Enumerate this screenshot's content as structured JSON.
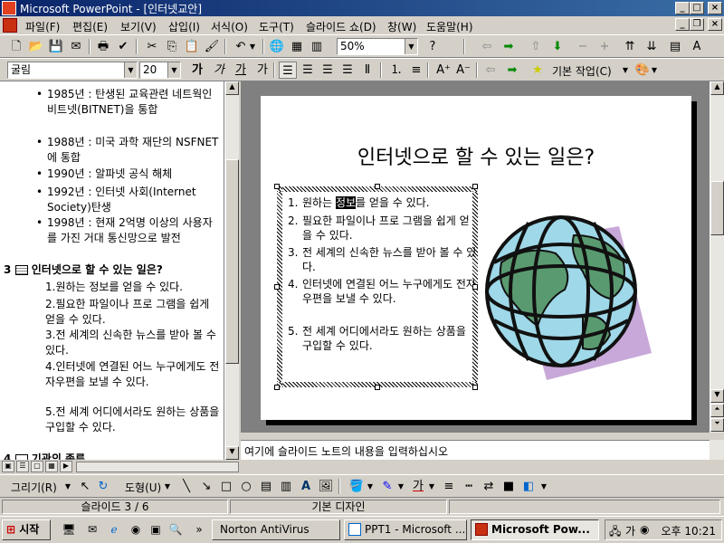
{
  "window": {
    "title": "Microsoft PowerPoint - [인터넷교안]",
    "caption_buttons": [
      "_",
      "□",
      "×"
    ],
    "doc_caption_buttons": [
      "_",
      "❐",
      "×"
    ]
  },
  "menu": [
    "파일(F)",
    "편집(E)",
    "보기(V)",
    "삽입(I)",
    "서식(O)",
    "도구(T)",
    "슬라이드 쇼(D)",
    "창(W)",
    "도움말(H)"
  ],
  "standard_toolbar": {
    "zoom": "50%"
  },
  "format_toolbar": {
    "font": "굴림",
    "size": "20",
    "char_style_labels": [
      "가",
      "가",
      "가",
      "가"
    ],
    "common_tasks": "기본 작업(C)"
  },
  "outline": {
    "bullets": [
      "1985년 : 탄생된 교육관련 네트웍인 비트넷(BITNET)을 통합",
      "1988년 : 미국 과학 재단의 NSFNET에 통합",
      "1990년 : 알파넷 공식 해체",
      "1992년 : 인터넷 사회(Internet Society)탄생",
      "1998년 : 현재 2억명 이상의 사용자를 가진 거대 통신망으로 발전"
    ],
    "slide3_number": "3",
    "slide3_title": "인터넷으로 할 수 있는 일은?",
    "slide3_items": [
      "1.원하는 정보를 얻을 수 있다.",
      "2.필요한  파일이나 프로 그램을 쉽게 얻을 수 있다.",
      "3.전 세계의 신속한 뉴스를 받아 볼 수 있다.",
      "4.인터넷에 연결된 어느 누구에게도 전자우편을 보낼 수 있다.",
      "5.전 세계 어디에서라도 원하는 상품을 구입할 수 있다."
    ],
    "slide4_number": "4",
    "slide4_title": "기관의 종류"
  },
  "slide": {
    "title": "인터넷으로 할 수 있는 일은?",
    "items": [
      {
        "num": "1.",
        "before": "원하는 ",
        "highlight": "정보",
        "after": "를 얻을 수 있다."
      },
      {
        "num": "2.",
        "text": "필요한  파일이나 프로 그램을 쉽게 얻을 수 있다."
      },
      {
        "num": "3.",
        "text": "전 세계의 신속한 뉴스를 받아 볼 수 있다."
      },
      {
        "num": "4.",
        "text": "인터넷에 연결된 어느 누구에게도 전자우편을 보낼 수 있다."
      },
      {
        "num": "5.",
        "text": "전 세계 어디에서라도 원하는 상품을 구입할 수 있다."
      }
    ]
  },
  "notes": {
    "placeholder": "여기에 슬라이드 노트의 내용을 입력하십시오"
  },
  "drawing_toolbar": {
    "draw": "그리기(R)",
    "autoshapes": "도형(U)"
  },
  "status": {
    "slide": "슬라이드 3 / 6",
    "design": "기본 디자인"
  },
  "taskbar": {
    "start": "시작",
    "tasks": [
      "Norton AntiVirus",
      "PPT1 - Microsoft ...",
      "Microsoft Pow..."
    ],
    "ime": "가",
    "clock": "오후 10:21"
  },
  "colors": {
    "titlebar_start": "#0a246a",
    "titlebar_end": "#3a6ea5",
    "globe_ocean": "#9fd8e8",
    "globe_land": "#5a9a70",
    "globe_shadow": "#c8a8d8"
  }
}
